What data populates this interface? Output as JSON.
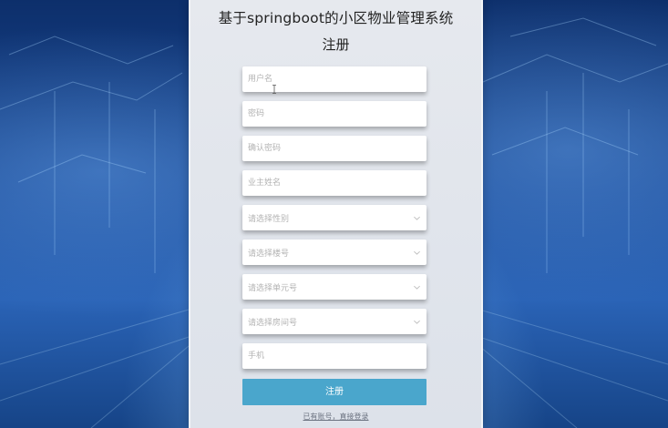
{
  "header": {
    "title": "基于springboot的小区物业管理系统",
    "subtitle": "注册"
  },
  "form": {
    "username": {
      "placeholder": "用户名",
      "value": ""
    },
    "password": {
      "placeholder": "密码",
      "value": ""
    },
    "confirm_password": {
      "placeholder": "确认密码",
      "value": ""
    },
    "owner_name": {
      "placeholder": "业主姓名",
      "value": ""
    },
    "gender_select": {
      "placeholder": "请选择性别"
    },
    "building_select": {
      "placeholder": "请选择楼号"
    },
    "unit_select": {
      "placeholder": "请选择单元号"
    },
    "room_select": {
      "placeholder": "请选择房间号"
    },
    "phone": {
      "placeholder": "手机",
      "value": ""
    }
  },
  "register_button": {
    "label": "注册"
  },
  "login_link": {
    "label": "已有账号，直接登录"
  },
  "colors": {
    "accent": "#4aa6cc",
    "panel_bg": "#e3e7ed",
    "background": "#1b4c9a"
  },
  "icons": {
    "select_arrow": "chevron-down-icon",
    "text_cursor": "text-cursor-icon"
  }
}
